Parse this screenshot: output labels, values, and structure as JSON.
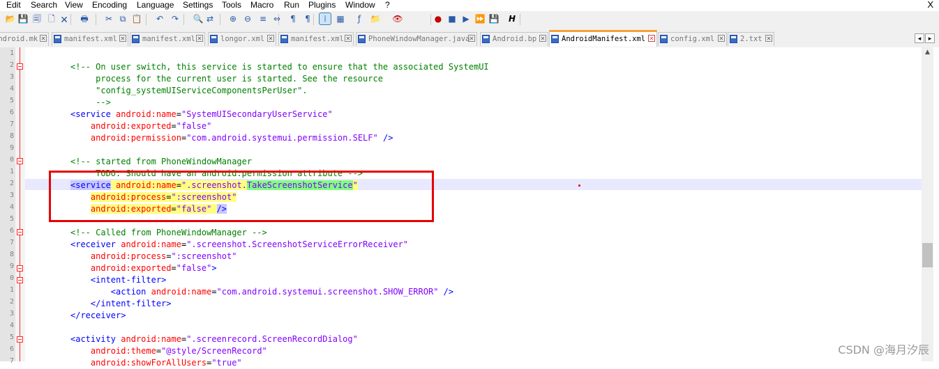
{
  "menu": {
    "items": [
      "Edit",
      "Search",
      "View",
      "Encoding",
      "Language",
      "Settings",
      "Tools",
      "Macro",
      "Run",
      "Plugins",
      "Window",
      "?"
    ],
    "close": "X"
  },
  "toolbar": {
    "icons": [
      "open-file-icon",
      "save-icon",
      "save-all-icon",
      "close-file-icon",
      "close-all-icon",
      "print-icon",
      "cut-icon",
      "copy-icon",
      "paste-icon",
      "undo-icon",
      "redo-icon",
      "find-icon",
      "replace-icon",
      "zoom-in-icon",
      "zoom-out-icon",
      "sync-vertical-icon",
      "sync-horizontal-icon",
      "word-wrap-icon",
      "show-all-chars-icon",
      "indent-guide-icon",
      "document-map-icon",
      "function-list-icon",
      "folder-workspace-icon",
      "monitoring-icon",
      "record-macro-icon",
      "stop-macro-icon",
      "play-macro-icon",
      "run-macro-multiple-icon",
      "save-macro-icon",
      "html-tag-icon"
    ],
    "glyphs": [
      "📂",
      "💾",
      "🗐",
      "🗋",
      "🗙",
      "🖶",
      "✂",
      "⧉",
      "📋",
      "↶",
      "↷",
      "🔍",
      "⇄",
      "⊕",
      "⊖",
      "≡",
      "⇔",
      "¶",
      "¶",
      "⁞",
      "▦",
      "ƒ",
      "📁",
      "👁",
      "●",
      "■",
      "▶",
      "⏩",
      "💾",
      "H"
    ]
  },
  "tabs": [
    {
      "label": "android.mk",
      "active": false
    },
    {
      "label": "manifest.xml",
      "active": false
    },
    {
      "label": "manifest.xml",
      "active": false
    },
    {
      "label": "longor.xml",
      "active": false
    },
    {
      "label": "manifest.xml",
      "active": false
    },
    {
      "label": "PhoneWindowManager.java",
      "active": false
    },
    {
      "label": "Android.bp",
      "active": false
    },
    {
      "label": "AndroidManifest.xml",
      "active": true
    },
    {
      "label": "config.xml",
      "active": false
    },
    {
      "label": "2.txt",
      "active": false
    }
  ],
  "tab_nav": {
    "left": "◂",
    "right": "▸"
  },
  "editor": {
    "line_numbers": [
      "1",
      "2",
      "3",
      "4",
      "5",
      "6",
      "7",
      "8",
      "9",
      "0",
      "1",
      "2",
      "3",
      "4",
      "5",
      "6",
      "7",
      "8",
      "9",
      "0",
      "1",
      "2",
      "3",
      "4",
      "5",
      "6",
      "7"
    ],
    "lines": [
      "",
      "<!-- On user switch, this service is started to ensure that the associated SystemUI",
      "     process for the current user is started. See the resource",
      "     \"config_systemUIServiceComponentsPerUser\".",
      "     -->",
      "<service android:name=\"SystemUISecondaryUserService\"",
      "    android:exported=\"false\"",
      "    android:permission=\"com.android.systemui.permission.SELF\" />",
      "",
      "<!-- started from PhoneWindowManager",
      "     TODO: Should have an android:permission attribute -->",
      "<service android:name=\".screenshot.TakeScreenshotService\"",
      "    android:process=\":screenshot\"",
      "    android:exported=\"false\" />",
      "",
      "<!-- Called from PhoneWindowManager -->",
      "<receiver android:name=\".screenshot.ScreenshotServiceErrorReceiver\"",
      "    android:process=\":screenshot\"",
      "    android:exported=\"false\">",
      "    <intent-filter>",
      "        <action android:name=\"com.android.systemui.screenshot.SHOW_ERROR\" />",
      "    </intent-filter>",
      "</receiver>",
      "",
      "<activity android:name=\".screenrecord.ScreenRecordDialog\"",
      "    android:theme=\"@style/ScreenRecord\"",
      "    android:showForAllUsers=\"true\""
    ]
  },
  "colors": {
    "comment": "#008000",
    "tag": "#0000ff",
    "attribute": "#ff0000",
    "string": "#8000ff",
    "annotation_box": "#e60000"
  },
  "watermark": "CSDN @海月汐辰"
}
